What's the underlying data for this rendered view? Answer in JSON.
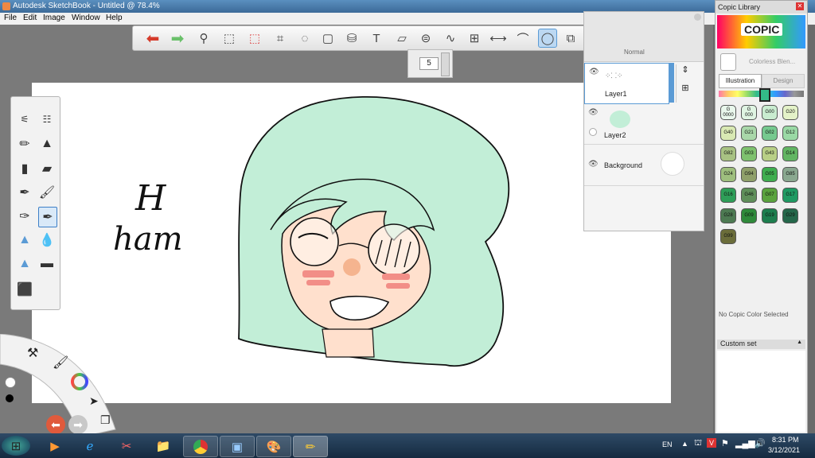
{
  "window": {
    "title": "Autodesk SketchBook - Untitled @ 78.4%"
  },
  "menu": [
    "File",
    "Edit",
    "Image",
    "Window",
    "Help"
  ],
  "toolbar": {
    "tools": [
      "undo-icon",
      "redo-icon",
      "zoom-icon",
      "rect-select-icon",
      "crop-select-icon",
      "crop-icon",
      "lasso-icon",
      "transform-icon",
      "bucket-icon",
      "text-icon",
      "ruler-icon",
      "ellipse-guide-icon",
      "curve-icon",
      "perspective-icon",
      "symmetry-icon",
      "stroke-icon",
      "ellipse-icon",
      "shape-icon",
      "copy-icon",
      "brushes-icon",
      "color-wheel-icon",
      "layers-icon"
    ],
    "brush_size": "5"
  },
  "layers": {
    "blend_mode": "Normal",
    "items": [
      {
        "name": "Layer1"
      },
      {
        "name": "Layer2"
      },
      {
        "name": "Background"
      }
    ]
  },
  "copic": {
    "title": "Copic Library",
    "logo": "COPIC",
    "colorless": "Colorless Blen...",
    "tabs": [
      "Illustration",
      "Design"
    ],
    "swatches": [
      {
        "code": "G\n0000",
        "color": "#e9f7ec"
      },
      {
        "code": "G\n000",
        "color": "#dff4e2"
      },
      {
        "code": "G00",
        "color": "#c9ecd0"
      },
      {
        "code": "G20",
        "color": "#e4f2c8"
      },
      {
        "code": "G40",
        "color": "#d9e9b3"
      },
      {
        "code": "G21",
        "color": "#a9d7a9"
      },
      {
        "code": "G02",
        "color": "#76c98f"
      },
      {
        "code": "G12",
        "color": "#9ad9a5"
      },
      {
        "code": "G82",
        "color": "#a8c283"
      },
      {
        "code": "G03",
        "color": "#7ec16e"
      },
      {
        "code": "G43",
        "color": "#b8cf86"
      },
      {
        "code": "G14",
        "color": "#62b563"
      },
      {
        "code": "G24",
        "color": "#9ebf7e"
      },
      {
        "code": "G94",
        "color": "#8fa06a"
      },
      {
        "code": "G05",
        "color": "#3fae4f"
      },
      {
        "code": "G85",
        "color": "#8aa890"
      },
      {
        "code": "G16",
        "color": "#2e9e58"
      },
      {
        "code": "G46",
        "color": "#5f8f5a"
      },
      {
        "code": "G07",
        "color": "#5aa33e"
      },
      {
        "code": "G17",
        "color": "#1f9a63"
      },
      {
        "code": "G28",
        "color": "#4d7a52"
      },
      {
        "code": "G09",
        "color": "#2f8a3a"
      },
      {
        "code": "G19",
        "color": "#1d7e4e"
      },
      {
        "code": "G29",
        "color": "#24674a"
      },
      {
        "code": "G99",
        "color": "#6b6d3a"
      }
    ],
    "status": "No Copic Color Selected",
    "custom_set": "Custom set"
  },
  "canvas": {
    "text_line1": "H",
    "text_line2": "ham"
  },
  "taskbar": {
    "lang": "EN",
    "time": "8:31 PM",
    "date": "3/12/2021"
  },
  "colors": {
    "accent": "#5b9bd5",
    "hair": "#c2eed7",
    "skin": "#ffe0cd",
    "blush": "#f28e87"
  }
}
